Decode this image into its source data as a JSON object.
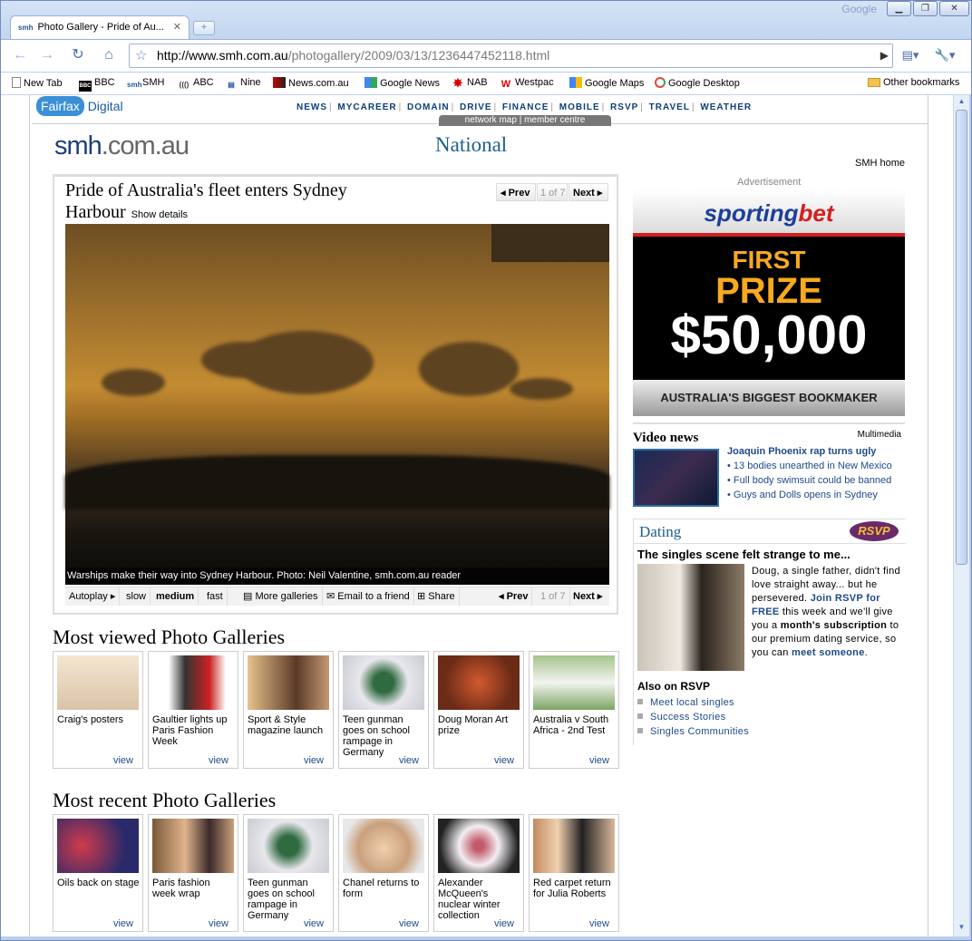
{
  "browser": {
    "title_brand": "Google",
    "tab_title": "Photo Gallery - Pride of Au...",
    "tab_favicon": "smh",
    "url_host": "http://www.smh.com.au",
    "url_path": "/photogallery/2009/03/13/1236447452118.html"
  },
  "bookmarks": [
    {
      "label": "New Tab",
      "icon": "page-icon"
    },
    {
      "label": "BBC",
      "icon": "bbc-icon"
    },
    {
      "label": "SMH",
      "icon": "smh-icon"
    },
    {
      "label": "ABC",
      "icon": "abc-icon"
    },
    {
      "label": "Nine",
      "icon": "nine-icon"
    },
    {
      "label": "News.com.au",
      "icon": "news-icon"
    },
    {
      "label": "Google News",
      "icon": "google-icon"
    },
    {
      "label": "NAB",
      "icon": "nab-icon"
    },
    {
      "label": "Westpac",
      "icon": "westpac-icon"
    },
    {
      "label": "Google Maps",
      "icon": "google-icon"
    },
    {
      "label": "Google Desktop",
      "icon": "google-desktop-icon"
    }
  ],
  "other_bookmarks": "Other bookmarks",
  "fairfax": {
    "logo_a": "Fairfax",
    "logo_b": "Digital",
    "nav": [
      "NEWS",
      "MYCAREER",
      "DOMAIN",
      "DRIVE",
      "FINANCE",
      "MOBILE",
      "RSVP",
      "TRAVEL",
      "WEATHER"
    ],
    "sub": "network map | member centre"
  },
  "site": {
    "logo_main": "smh",
    "logo_domain": ".com.au",
    "section": "National",
    "home_link": "SMH home"
  },
  "gallery": {
    "title": "Pride of Australia's fleet enters Sydney Harbour",
    "show_details": "Show details",
    "prev": "Prev",
    "next": "Next",
    "counter": "1 of 7",
    "caption": "Warships make their way into Sydney Harbour. Photo: Neil Valentine, smh.com.au reader",
    "controls": {
      "autoplay": "Autoplay",
      "slow": "slow",
      "medium": "medium",
      "fast": "fast",
      "more": "More galleries",
      "email": "Email to a friend",
      "share": "Share"
    }
  },
  "most_viewed": {
    "title": "Most viewed Photo Galleries",
    "items": [
      {
        "label": "Craig's posters",
        "view": "view"
      },
      {
        "label": "Gaultier lights up Paris Fashion Week",
        "view": "view"
      },
      {
        "label": "Sport & Style magazine launch",
        "view": "view"
      },
      {
        "label": "Teen gunman goes on school rampage in Germany",
        "view": "view"
      },
      {
        "label": "Doug Moran Art prize",
        "view": "view"
      },
      {
        "label": "Australia v South Africa - 2nd Test",
        "view": "view"
      }
    ]
  },
  "most_recent": {
    "title": "Most recent Photo Galleries",
    "items": [
      {
        "label": "Oils back on stage",
        "view": "view"
      },
      {
        "label": "Paris fashion week wrap",
        "view": "view"
      },
      {
        "label": "Teen gunman goes on school rampage in Germany",
        "view": "view"
      },
      {
        "label": "Chanel returns to form",
        "view": "view"
      },
      {
        "label": "Alexander McQueen's nuclear winter collection",
        "view": "view"
      },
      {
        "label": "Red carpet return for Julia Roberts",
        "view": "view"
      }
    ]
  },
  "advert": {
    "label": "Advertisement",
    "brand_a": "sporting",
    "brand_b": "bet",
    "first": "FIRST",
    "prize": "PRIZE",
    "amount": "$50,000",
    "tagline": "AUSTRALIA'S BIGGEST BOOKMAKER"
  },
  "video_news": {
    "title": "Video news",
    "multimedia": "Multimedia",
    "lead": "Joaquin Phoenix rap turns ugly",
    "items": [
      "13 bodies unearthed in New Mexico",
      "Full body swimsuit could be banned",
      "Guys and Dolls opens in Sydney"
    ]
  },
  "dating": {
    "title": "Dating",
    "badge": "RSVP",
    "headline": "The singles scene felt strange to me...",
    "body_1": "Doug, a single father, didn't find love straight away... but he persevered. ",
    "link_1": "Join RSVP for FREE",
    "body_2": " this week and we'll give you a ",
    "bold_1": "month's subscription",
    "body_3": " to our premium dating service, so you can ",
    "link_2": "meet someone",
    "body_4": ".",
    "also": "Also on RSVP",
    "links": [
      "Meet local singles",
      "Success Stories",
      "Singles Communities"
    ]
  }
}
